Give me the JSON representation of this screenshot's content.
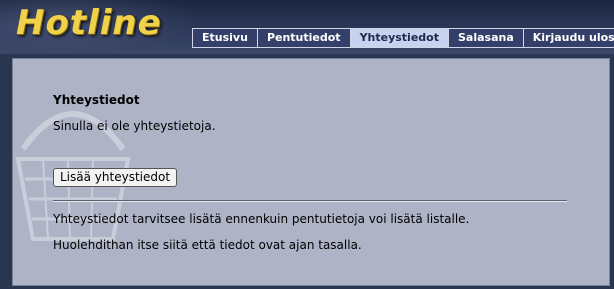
{
  "header": {
    "logo_text": "Hotline"
  },
  "nav": {
    "tabs": [
      {
        "label": "Etusivu",
        "active": false
      },
      {
        "label": "Pentutiedot",
        "active": false
      },
      {
        "label": "Yhteystiedot",
        "active": true
      },
      {
        "label": "Salasana",
        "active": false
      },
      {
        "label": "Kirjaudu ulos",
        "active": false
      }
    ]
  },
  "main": {
    "heading": "Yhteystiedot",
    "empty_text": "Sinulla ei ole yhteystietoja.",
    "add_button_label": "Lisää yhteystiedot",
    "info_line_1": "Yhteystiedot tarvitsee lisätä ennenkuin pentutietoja voi lisätä listalle.",
    "info_line_2": "Huolehdithan itse siitä että tiedot ovat ajan tasalla."
  },
  "colors": {
    "logo": "#f0d24a",
    "tab_bg": "#34406a",
    "tab_active_bg": "#c6d2ee",
    "panel_bg": "#aeb4c6"
  }
}
